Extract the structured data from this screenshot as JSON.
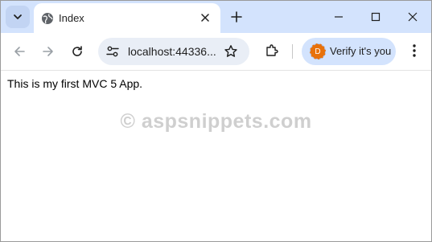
{
  "tab": {
    "title": "Index"
  },
  "omnibox": {
    "url": "localhost:44336..."
  },
  "profile": {
    "label": "Verify it's you",
    "avatar_letter": "D"
  },
  "page": {
    "text": "This is my first MVC 5 App."
  },
  "watermark": "© aspsnippets.com",
  "colors": {
    "tabstrip": "#d3e3fd",
    "omnibox": "#e9eef6",
    "profile_pill": "#d3e3fd",
    "avatar": "#e8710a"
  }
}
